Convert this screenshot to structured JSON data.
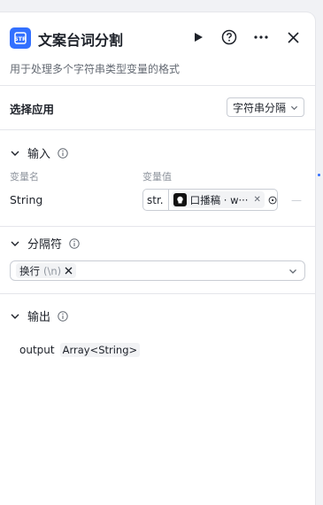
{
  "header": {
    "title": "文案台词分割",
    "description": "用于处理多个字符串类型变量的格式",
    "icons": [
      "text-split-app-icon",
      "play-icon",
      "help-icon",
      "more-icon",
      "close-icon"
    ]
  },
  "select_app": {
    "label": "选择应用",
    "value": "字符串分隔"
  },
  "input_section": {
    "title": "输入",
    "col_name": "变量名",
    "col_value": "变量值",
    "rows": [
      {
        "name": "String",
        "type_tag": "str.",
        "ref_label": "口播稿 · w···"
      }
    ]
  },
  "separator_section": {
    "title": "分隔符",
    "tag_label": "换行",
    "tag_code": "(\\n)"
  },
  "output_section": {
    "title": "输出",
    "name": "output",
    "type": "Array<String>"
  },
  "colors": {
    "accent": "#3370ff",
    "border": "#c9cdd4",
    "muted_text": "#8f959e"
  }
}
